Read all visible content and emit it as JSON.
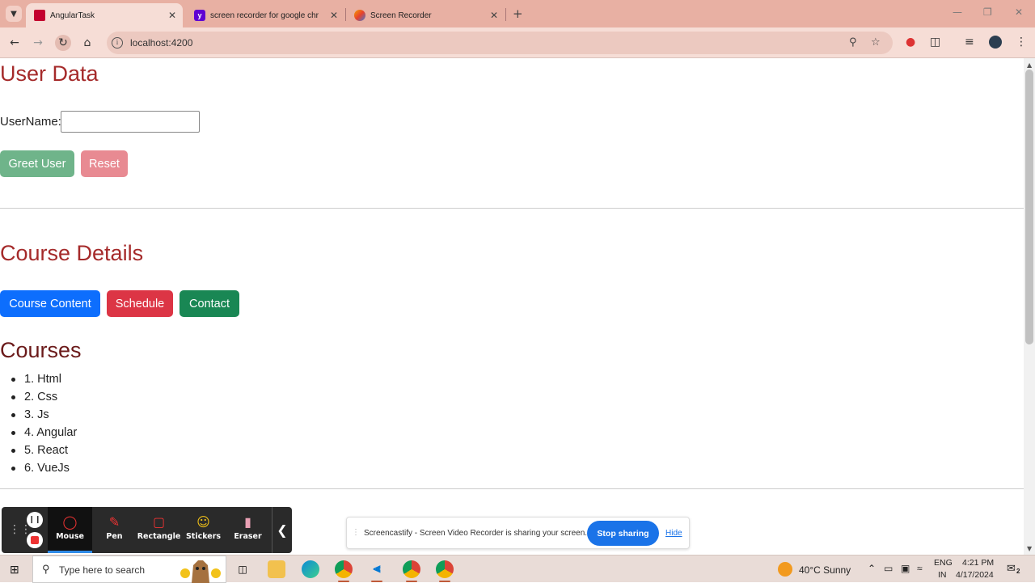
{
  "browser": {
    "tabs": [
      {
        "title": "AngularTask",
        "active": true
      },
      {
        "title": "screen recorder for google chr",
        "active": false
      },
      {
        "title": "Screen Recorder",
        "active": false
      }
    ],
    "url": "localhost:4200"
  },
  "page": {
    "user_section_title": "User Data",
    "username_label": "UserName:",
    "username_value": "",
    "greet_button": "Greet User",
    "reset_button": "Reset",
    "course_details_title": "Course Details",
    "course_content_button": "Course Content",
    "schedule_button": "Schedule",
    "contact_button": "Contact",
    "courses_title": "Courses",
    "courses": [
      "1. Html",
      "2. Css",
      "3. Js",
      "4. Angular",
      "5. React",
      "6. VueJs"
    ]
  },
  "recorder_toolbar": {
    "tools": [
      {
        "label": "Mouse",
        "icon": "mouse-cursor-icon",
        "active": true
      },
      {
        "label": "Pen",
        "icon": "pen-icon",
        "active": false
      },
      {
        "label": "Rectangle",
        "icon": "rectangle-icon",
        "active": false
      },
      {
        "label": "Stickers",
        "icon": "sticker-icon",
        "active": false
      },
      {
        "label": "Eraser",
        "icon": "eraser-icon",
        "active": false
      }
    ]
  },
  "share_bar": {
    "message": "Screencastify - Screen Video Recorder is sharing your screen.",
    "stop_label": "Stop sharing",
    "hide_label": "Hide"
  },
  "taskbar": {
    "search_placeholder": "Type here to search",
    "weather": "40°C  Sunny",
    "lang_line1": "ENG",
    "lang_line2": "IN",
    "time": "4:21 PM",
    "date": "4/17/2024",
    "notification_count": "2"
  },
  "colors": {
    "heading": "#a52a2a",
    "greet_button": "#6fb48a",
    "reset_button": "#e88a92",
    "course_content_button": "#0d6efd",
    "schedule_button": "#dc3545",
    "contact_button": "#198754",
    "stop_sharing": "#1a73e8"
  }
}
